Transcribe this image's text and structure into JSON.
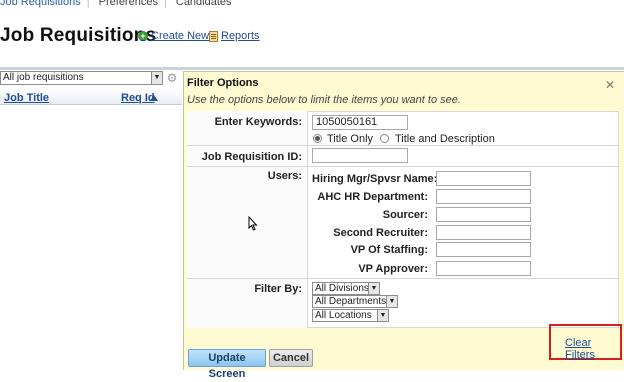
{
  "topnav": {
    "items": [
      "Job Requisitions",
      "Preferences",
      "Candidates"
    ]
  },
  "header": {
    "title": "Job Requisitions",
    "create_new": "Create New",
    "reports": "Reports"
  },
  "left": {
    "view_select": "All job requisitions",
    "col_job_title": "Job Title",
    "col_req_id": "Req Id"
  },
  "filter": {
    "title": "Filter Options",
    "subtitle": "Use the options below to limit the items you want to see.",
    "keywords_label": "Enter Keywords:",
    "keywords_value": "1050050161",
    "radio_title_only": "Title Only",
    "radio_title_desc": "Title and Description",
    "req_id_label": "Job Requisition ID:",
    "req_id_value": "",
    "users_label": "Users:",
    "users": [
      "Hiring Mgr/Spvsr Name:",
      "AHC HR Department:",
      "Sourcer:",
      "Second Recruiter:",
      "VP Of Staffing:",
      "VP Approver:"
    ],
    "filter_by_label": "Filter By:",
    "divisions": "All Divisions",
    "departments": "All Departments",
    "locations": "All Locations",
    "clear_filters": "Clear Filters",
    "update_button": "Update Screen",
    "cancel_button": "Cancel"
  },
  "colors": {
    "panel_bg": "#fefbd3",
    "link": "#1f4f93",
    "highlight": "#d51e1e"
  }
}
